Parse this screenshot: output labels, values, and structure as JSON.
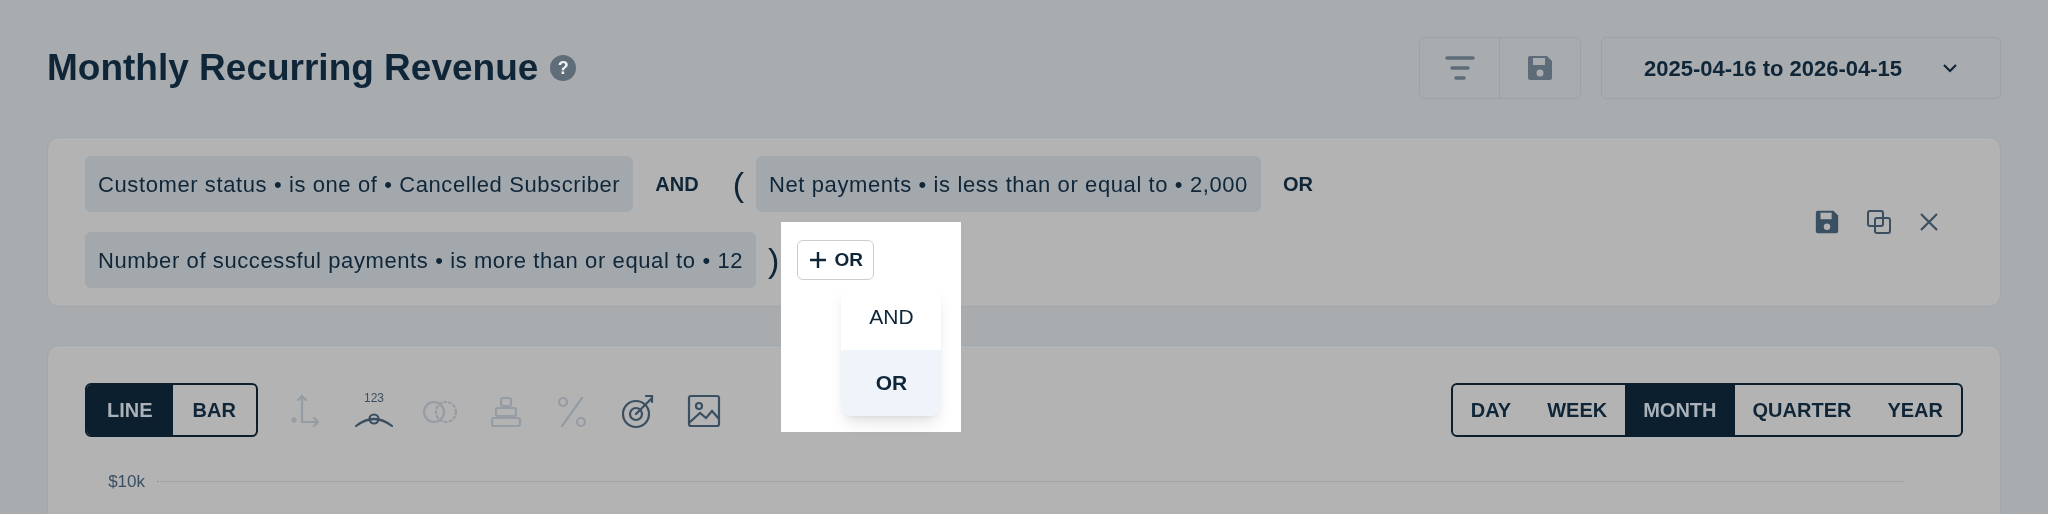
{
  "title": "Monthly Recurring Revenue",
  "help_mark": "?",
  "date_range": "2025-04-16 to 2026-04-15",
  "filter_rows": [
    [
      {
        "kind": "condition",
        "text": "Customer status • is one of • Cancelled Subscriber"
      },
      {
        "kind": "operator",
        "text": "AND"
      },
      {
        "kind": "paren",
        "text": "("
      },
      {
        "kind": "condition",
        "text": "Net payments • is less than or equal to • 2,000"
      },
      {
        "kind": "operator",
        "text": "OR"
      }
    ],
    [
      {
        "kind": "condition",
        "text": "Number of successful payments • is more than or equal to • 12"
      },
      {
        "kind": "paren",
        "text": ")"
      },
      {
        "kind": "add",
        "text": "OR"
      }
    ]
  ],
  "operator_menu": [
    {
      "label": "AND",
      "selected": false
    },
    {
      "label": "OR",
      "selected": true
    }
  ],
  "chart_types": [
    {
      "label": "LINE",
      "selected": true
    },
    {
      "label": "BAR",
      "selected": false
    }
  ],
  "tools": [
    {
      "kind": "axes",
      "disabled": true
    },
    {
      "kind": "values",
      "disabled": false,
      "text": "123"
    },
    {
      "kind": "compare",
      "disabled": true
    },
    {
      "kind": "stack",
      "disabled": true
    },
    {
      "kind": "percent",
      "disabled": true
    },
    {
      "kind": "goal",
      "disabled": false
    },
    {
      "kind": "image",
      "disabled": false
    }
  ],
  "periods": [
    {
      "label": "DAY",
      "selected": false
    },
    {
      "label": "WEEK",
      "selected": false
    },
    {
      "label": "MONTH",
      "selected": true
    },
    {
      "label": "QUARTER",
      "selected": false
    },
    {
      "label": "YEAR",
      "selected": false
    }
  ],
  "y_axis_label": "$10k"
}
